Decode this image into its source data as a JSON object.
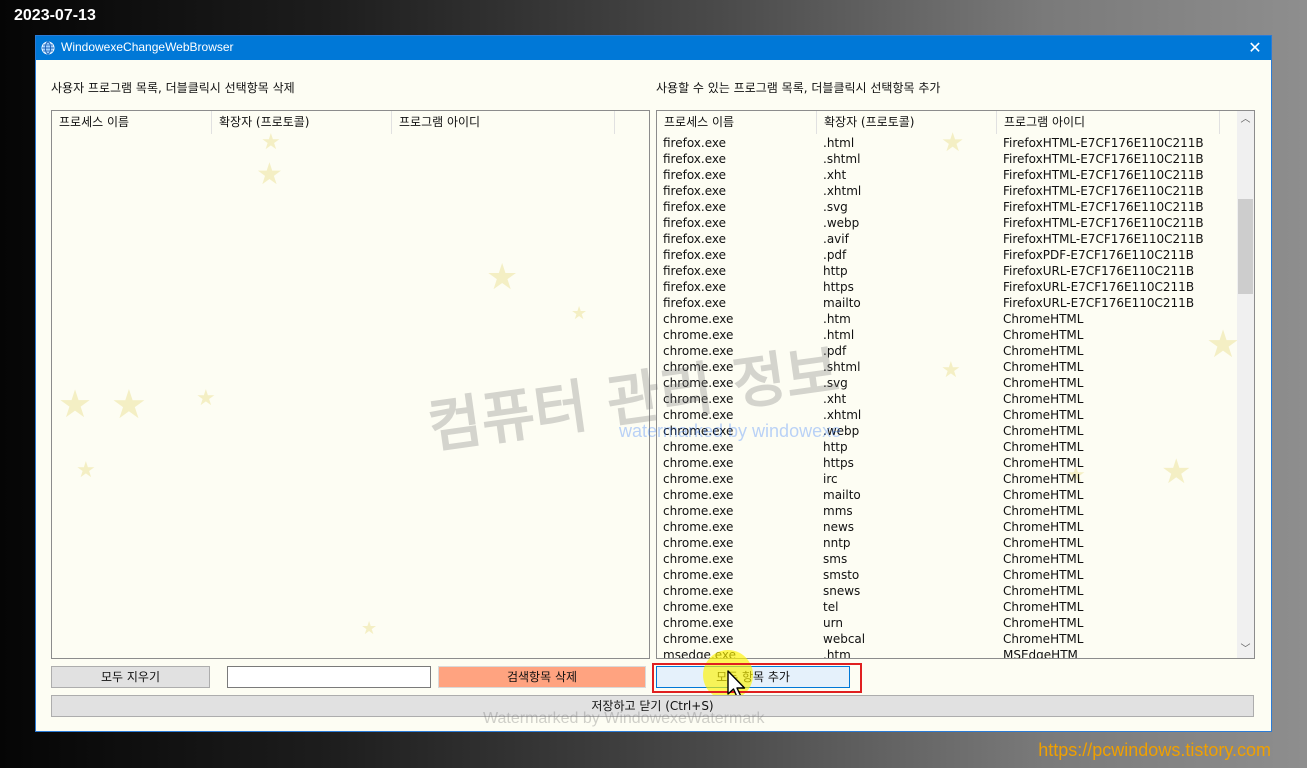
{
  "overlay": {
    "date": "2023-07-13",
    "site_url": "https://pcwindows.tistory.com"
  },
  "window": {
    "title": "WindowexeChangeWebBrowser",
    "close_glyph": "✕",
    "icon": "globe-icon"
  },
  "left_panel": {
    "label": "사용자 프로그램 목록, 더블클릭시 선택항목 삭제",
    "columns": [
      "프로세스 이름",
      "확장자 (프로토콜)",
      "프로그램 아이디"
    ],
    "rows": []
  },
  "right_panel": {
    "label": "사용할 수 있는 프로그램 목록, 더블클릭시 선택항목 추가",
    "columns": [
      "프로세스 이름",
      "확장자 (프로토콜)",
      "프로그램 아이디"
    ],
    "rows": [
      [
        "firefox.exe",
        ".html",
        "FirefoxHTML-E7CF176E110C211B"
      ],
      [
        "firefox.exe",
        ".shtml",
        "FirefoxHTML-E7CF176E110C211B"
      ],
      [
        "firefox.exe",
        ".xht",
        "FirefoxHTML-E7CF176E110C211B"
      ],
      [
        "firefox.exe",
        ".xhtml",
        "FirefoxHTML-E7CF176E110C211B"
      ],
      [
        "firefox.exe",
        ".svg",
        "FirefoxHTML-E7CF176E110C211B"
      ],
      [
        "firefox.exe",
        ".webp",
        "FirefoxHTML-E7CF176E110C211B"
      ],
      [
        "firefox.exe",
        ".avif",
        "FirefoxHTML-E7CF176E110C211B"
      ],
      [
        "firefox.exe",
        ".pdf",
        "FirefoxPDF-E7CF176E110C211B"
      ],
      [
        "firefox.exe",
        "http",
        "FirefoxURL-E7CF176E110C211B"
      ],
      [
        "firefox.exe",
        "https",
        "FirefoxURL-E7CF176E110C211B"
      ],
      [
        "firefox.exe",
        "mailto",
        "FirefoxURL-E7CF176E110C211B"
      ],
      [
        "chrome.exe",
        ".htm",
        "ChromeHTML"
      ],
      [
        "chrome.exe",
        ".html",
        "ChromeHTML"
      ],
      [
        "chrome.exe",
        ".pdf",
        "ChromeHTML"
      ],
      [
        "chrome.exe",
        ".shtml",
        "ChromeHTML"
      ],
      [
        "chrome.exe",
        ".svg",
        "ChromeHTML"
      ],
      [
        "chrome.exe",
        ".xht",
        "ChromeHTML"
      ],
      [
        "chrome.exe",
        ".xhtml",
        "ChromeHTML"
      ],
      [
        "chrome.exe",
        ".webp",
        "ChromeHTML"
      ],
      [
        "chrome.exe",
        "http",
        "ChromeHTML"
      ],
      [
        "chrome.exe",
        "https",
        "ChromeHTML"
      ],
      [
        "chrome.exe",
        "irc",
        "ChromeHTML"
      ],
      [
        "chrome.exe",
        "mailto",
        "ChromeHTML"
      ],
      [
        "chrome.exe",
        "mms",
        "ChromeHTML"
      ],
      [
        "chrome.exe",
        "news",
        "ChromeHTML"
      ],
      [
        "chrome.exe",
        "nntp",
        "ChromeHTML"
      ],
      [
        "chrome.exe",
        "sms",
        "ChromeHTML"
      ],
      [
        "chrome.exe",
        "smsto",
        "ChromeHTML"
      ],
      [
        "chrome.exe",
        "snews",
        "ChromeHTML"
      ],
      [
        "chrome.exe",
        "tel",
        "ChromeHTML"
      ],
      [
        "chrome.exe",
        "urn",
        "ChromeHTML"
      ],
      [
        "chrome.exe",
        "webcal",
        "ChromeHTML"
      ],
      [
        "msedge.exe",
        ".htm",
        "MSEdgeHTM"
      ]
    ],
    "scroll_up_glyph": "︿",
    "scroll_down_glyph": "﹀"
  },
  "buttons": {
    "clear_all": "모두 지우기",
    "search_value": "",
    "delete_searched": "검색항목 삭제",
    "add_all": "모두 항목 추가",
    "save_close": "저장하고 닫기 (Ctrl+S)"
  },
  "watermarks": {
    "korean": "컴퓨터 관리 정보",
    "by": "watermarked by windowexe",
    "bottom": "Watermarked by WindowexeWatermark"
  },
  "colors": {
    "titlebar": "#0078d7",
    "delete_button": "#ffa380",
    "add_button": "#e5f1fb",
    "highlight": "#e02020",
    "url_text": "#f0a000"
  }
}
